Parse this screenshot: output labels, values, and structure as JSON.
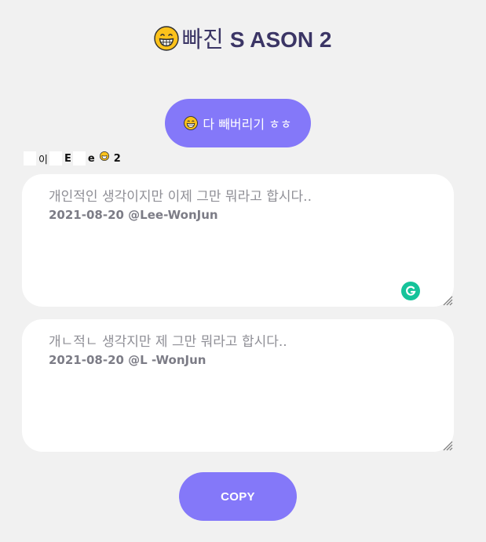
{
  "title": {
    "emoji_icon": "grinning-face-emoji",
    "korean": "빠진",
    "season": "S ASON 2"
  },
  "convert_button": {
    "emoji_icon": "grinning-face-emoji",
    "label": "다 빼버리기 ㅎㅎ"
  },
  "caption": {
    "part1": "이",
    "part2": "E",
    "part3": "e",
    "part4": "2",
    "emoji_icon": "grinning-face-emoji"
  },
  "input_box": {
    "line1": "개인적인 생각이지만 이제 그만 뭐라고 합시다..",
    "line2": "2021-08-20 @Lee-WonJun",
    "grammarly_icon": "grammarly-icon"
  },
  "output_box": {
    "line1": "개ㄴ적ㄴ 생각지만 제 그만 뭐라고 합시다..",
    "line2": "2021-08-20 @L  -WonJun"
  },
  "copy_button": {
    "label": "COPY"
  },
  "colors": {
    "background": "#f1f1f1",
    "accent": "#8478f9",
    "title": "#3b3565",
    "grammarly": "#15c39a"
  }
}
